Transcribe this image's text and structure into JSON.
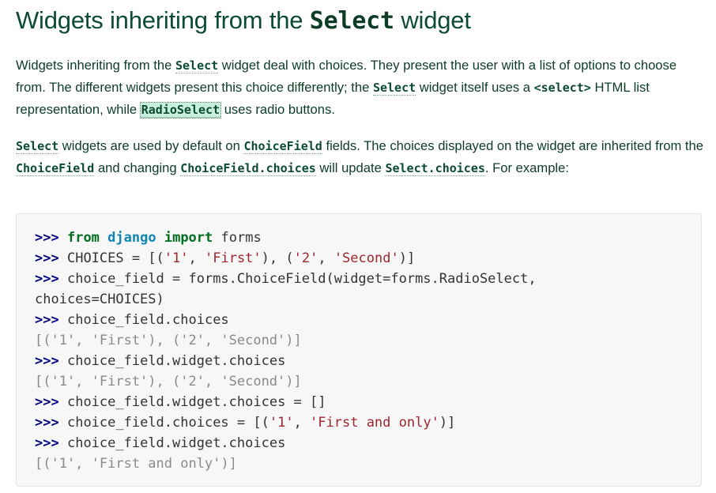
{
  "heading": {
    "prefix": "Widgets inheriting from the ",
    "code": "Select",
    "suffix": " widget"
  },
  "para1": {
    "t1": "Widgets inheriting from the ",
    "r1": "Select",
    "t2": " widget deal with choices. They present the user with a list of options to choose from. The different widgets present this choice differently; the ",
    "r2": "Select",
    "t3": " widget itself uses a ",
    "lit1": "<select>",
    "t4": " HTML list representation, while ",
    "r3": "RadioSelect",
    "t5": " uses radio buttons."
  },
  "para2": {
    "r1": "Select",
    "t1": " widgets are used by default on ",
    "r2": "ChoiceField",
    "t2": " fields. The choices displayed on the widget are inherited from the ",
    "r3": "ChoiceField",
    "t3": " and changing ",
    "r4": "ChoiceField.choices",
    "t4": " will update ",
    "r5": "Select.choices",
    "t5": ". For example:"
  },
  "code": {
    "prompt": ">>>",
    "l1_kw1": "from",
    "l1_mod": "django",
    "l1_kw2": "import",
    "l1_rest": "forms",
    "l2_a": "CHOICES = [(",
    "l2_s1": "'1'",
    "l2_b": ", ",
    "l2_s2": "'First'",
    "l2_c": "), (",
    "l2_s3": "'2'",
    "l2_d": ", ",
    "l2_s4": "'Second'",
    "l2_e": ")]",
    "l3": "choice_field = forms.ChoiceField(widget=forms.RadioSelect,",
    "l4": "choices=CHOICES)",
    "l5": "choice_field.choices",
    "l6": "[('1', 'First'), ('2', 'Second')]",
    "l7": "choice_field.widget.choices",
    "l8": "[('1', 'First'), ('2', 'Second')]",
    "l9": "choice_field.widget.choices = []",
    "l10_a": "choice_field.choices = [(",
    "l10_s1": "'1'",
    "l10_b": ", ",
    "l10_s2": "'First and only'",
    "l10_c": ")]",
    "l11": "choice_field.widget.choices",
    "l12": "[('1', 'First and only')]"
  }
}
